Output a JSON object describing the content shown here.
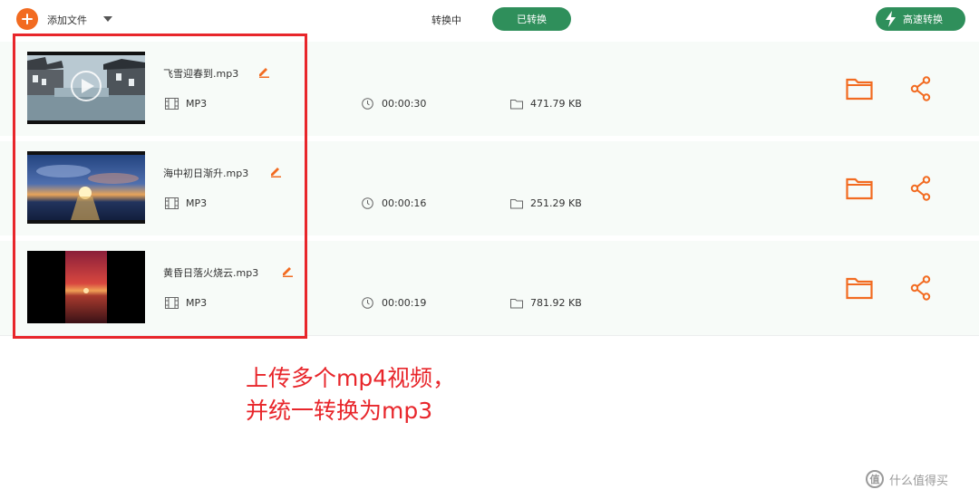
{
  "toolbar": {
    "add_label": "添加文件",
    "tab_converting": "转换中",
    "tab_converted": "已转换",
    "speed_label": "高速转换"
  },
  "files": [
    {
      "name": "飞雪迎春到.mp3",
      "format": "MP3",
      "duration": "00:00:30",
      "size": "471.79 KB"
    },
    {
      "name": "海中初日渐升.mp3",
      "format": "MP3",
      "duration": "00:00:16",
      "size": "251.29 KB"
    },
    {
      "name": "黄昏日落火烧云.mp3",
      "format": "MP3",
      "duration": "00:00:19",
      "size": "781.92 KB"
    }
  ],
  "annotation": {
    "line1": "上传多个mp4视频，",
    "line2": "并统一转换为mp3"
  },
  "watermark": {
    "text": "什么值得买",
    "logo": "值"
  },
  "colors": {
    "accent_orange": "#f26b21",
    "accent_green": "#2f8f5b",
    "annotation_red": "#e8262b"
  }
}
